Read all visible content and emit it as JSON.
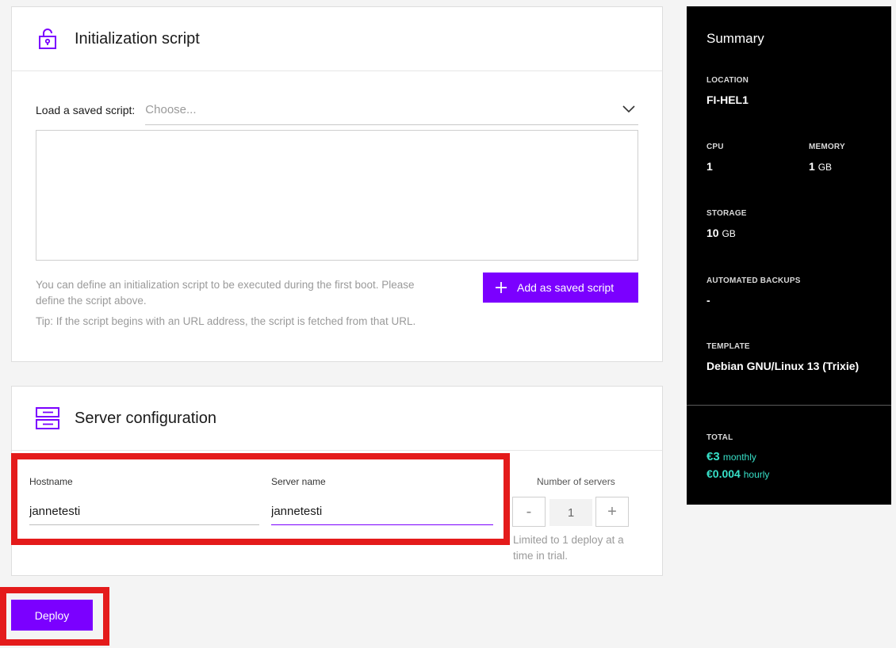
{
  "init_script": {
    "title": "Initialization script",
    "load_label": "Load a saved script:",
    "select_placeholder": "Choose...",
    "script_value": "",
    "help_text": "You can define an initialization script to be executed during the first boot. Please define the script above.",
    "tip_text": "Tip: If the script begins with an URL address, the script is fetched from that URL.",
    "add_button_label": "Add as saved script"
  },
  "server_config": {
    "title": "Server configuration",
    "hostname_label": "Hostname",
    "hostname_value": "jannetesti",
    "server_name_label": "Server name",
    "server_name_value": "jannetesti",
    "num_servers_label": "Number of servers",
    "decrement_label": "-",
    "increment_label": "+",
    "num_servers_value": "1",
    "limit_note": "Limited to 1 deploy at a time in trial."
  },
  "deploy_label": "Deploy",
  "summary": {
    "title": "Summary",
    "location_label": "LOCATION",
    "location_value": "FI-HEL1",
    "cpu_label": "CPU",
    "cpu_value": "1",
    "memory_label": "MEMORY",
    "memory_value": "1",
    "memory_unit": "GB",
    "storage_label": "STORAGE",
    "storage_value": "10",
    "storage_unit": "GB",
    "backups_label": "AUTOMATED BACKUPS",
    "backups_value": "-",
    "template_label": "TEMPLATE",
    "template_value": "Debian GNU/Linux 13 (Trixie)",
    "total_label": "TOTAL",
    "monthly_price": "€3",
    "monthly_unit": "monthly",
    "hourly_price": "€0.004",
    "hourly_unit": "hourly"
  },
  "colors": {
    "accent": "#7b00ff",
    "highlight": "#e41b1b",
    "price": "#37e0c8"
  },
  "icons": {
    "init_script": "unlock-icon",
    "server_config": "server-icon",
    "select": "chevron-down-icon",
    "add": "plus-icon"
  }
}
